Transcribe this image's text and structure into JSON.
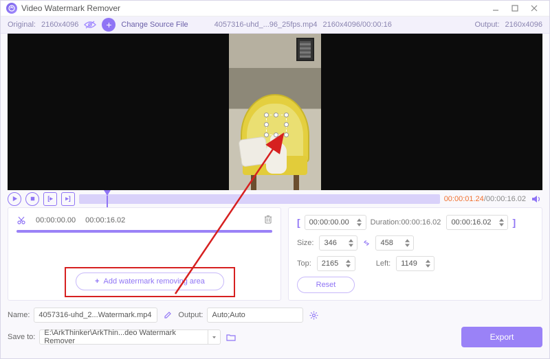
{
  "titlebar": {
    "title": "Video Watermark Remover"
  },
  "topbar": {
    "original_label": "Original:",
    "original_res": "2160x4096",
    "change_source": "Change Source File",
    "filename": "4057316-uhd_...96_25fps.mp4",
    "src_meta": "2160x4096/00:00:16",
    "output_label": "Output:",
    "output_res": "2160x4096"
  },
  "playback": {
    "current": "00:00:01.24",
    "total": "00:00:16.02"
  },
  "segment": {
    "start": "00:00:00.00",
    "end": "00:00:16.02"
  },
  "range": {
    "start": "00:00:00.00",
    "duration_label": "Duration:",
    "duration": "00:00:16.02",
    "end": "00:00:16.02"
  },
  "size": {
    "label": "Size:",
    "w": "346",
    "h": "458"
  },
  "pos": {
    "top_label": "Top:",
    "top": "2165",
    "left_label": "Left:",
    "left": "1149"
  },
  "buttons": {
    "add_area": "Add watermark removing area",
    "reset": "Reset",
    "export": "Export"
  },
  "footer": {
    "name_label": "Name:",
    "name_value": "4057316-uhd_2...Watermark.mp4",
    "output_label": "Output:",
    "output_value": "Auto;Auto",
    "saveto_label": "Save to:",
    "saveto_value": "E:\\ArkThinker\\ArkThin...deo Watermark Remover"
  }
}
